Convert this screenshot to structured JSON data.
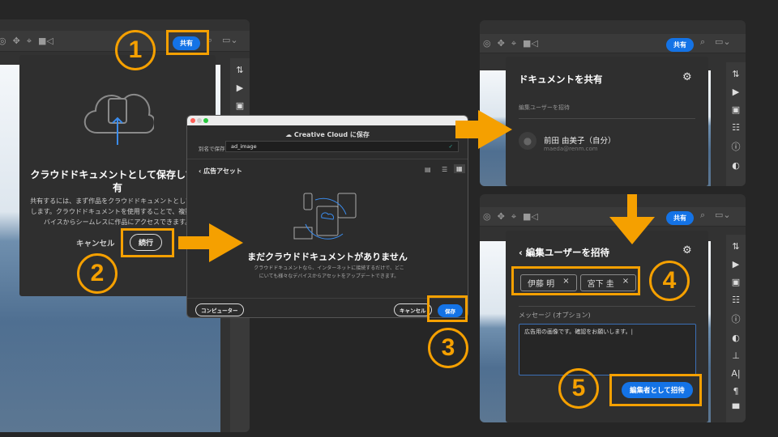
{
  "colors": {
    "accent": "#1473e6",
    "highlight": "#f5a000"
  },
  "step1": {
    "share_label": "共有"
  },
  "cloud_dialog": {
    "title": "クラウドドキュメントとして保存して共有",
    "body": "共有するには、まず作品をクラウドドキュメントとして保存します。クラウドドキュメントを使用することで、複数のデバイスからシームレスに作品にアクセスできます。",
    "cancel_label": "キャンセル",
    "continue_label": "続行"
  },
  "save_dialog": {
    "title": "Creative Cloud に保存",
    "save_as_label": "別名で保存",
    "filename": "ad_image",
    "breadcrumb": "広告アセット",
    "empty_heading": "まだクラウドドキュメントがありません",
    "empty_body": "クラウドドキュメントなら、インターネットに接続するだけで、どこにいても様々なデバイスからアセットをアップデートできます。",
    "computer_label": "コンピューター",
    "cancel_label": "キャンセル",
    "save_label": "保存"
  },
  "share_panel": {
    "title": "ドキュメントを共有",
    "invite_label": "編集ユーザーを招待",
    "user_name": "前田 由美子（自分）",
    "user_email": "maeda@renm.com"
  },
  "invite_panel": {
    "title": "編集ユーザーを招待",
    "chips": [
      "伊藤 明",
      "宮下 圭"
    ],
    "message_label": "メッセージ (オプション)",
    "message_value": "広告用の画像です。確認をお願いします。",
    "invite_button": "編集者として招待"
  },
  "steps": [
    "1",
    "2",
    "3",
    "4",
    "5"
  ]
}
